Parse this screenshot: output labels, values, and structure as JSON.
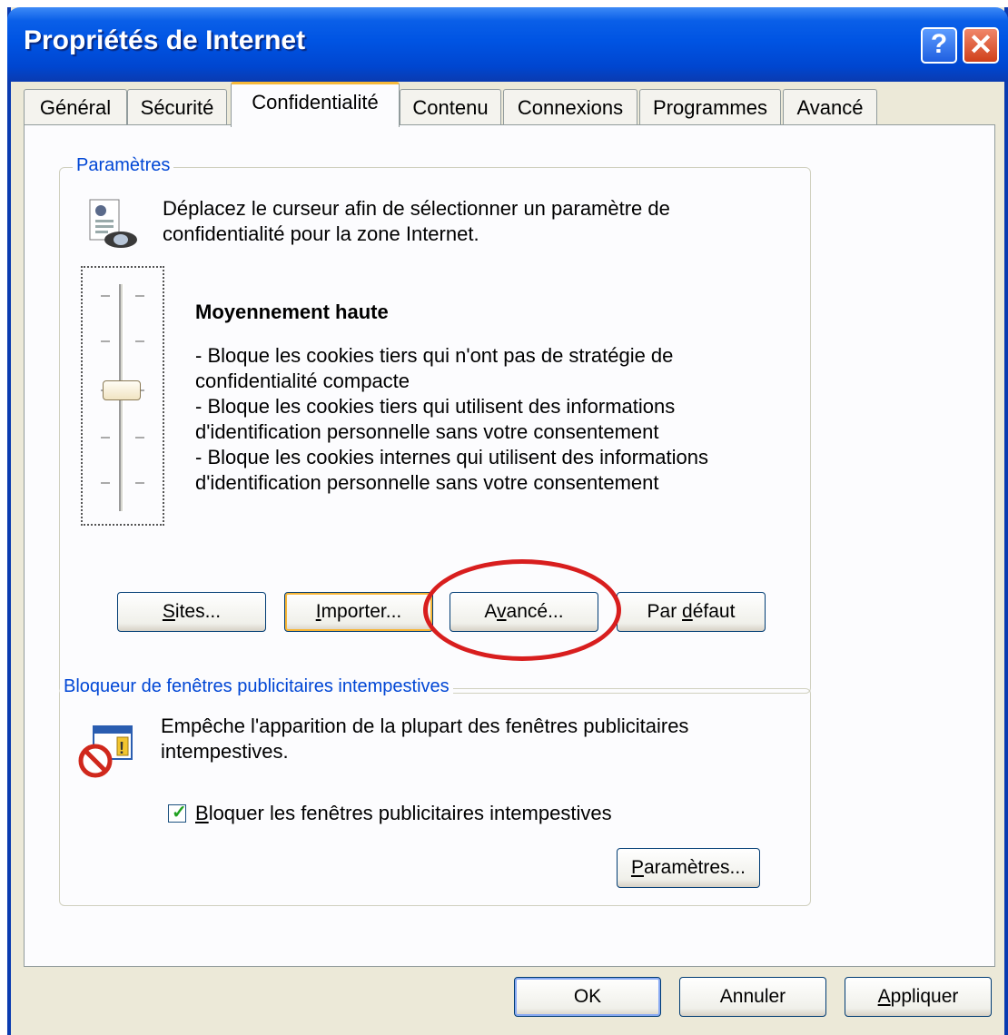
{
  "window": {
    "title": "Propriétés de Internet",
    "help_glyph": "?",
    "close_glyph": "✕"
  },
  "tabs": [
    {
      "label": "Général",
      "active": false
    },
    {
      "label": "Sécurité",
      "active": false
    },
    {
      "label": "Confidentialité",
      "active": true
    },
    {
      "label": "Contenu",
      "active": false
    },
    {
      "label": "Connexions",
      "active": false
    },
    {
      "label": "Programmes",
      "active": false
    },
    {
      "label": "Avancé",
      "active": false
    }
  ],
  "settings": {
    "legend": "Paramètres",
    "description_line1": "Déplacez le curseur afin de sélectionner un paramètre de",
    "description_line2": "confidentialité pour la zone Internet.",
    "level_title": "Moyennement haute",
    "level_lines": [
      "- Bloque les cookies tiers qui n'ont pas de stratégie de",
      "confidentialité compacte",
      "- Bloque les cookies tiers qui utilisent des informations",
      "d'identification personnelle sans votre consentement",
      "- Bloque les cookies internes qui utilisent des informations",
      "d'identification personnelle sans votre consentement"
    ],
    "slider_level": "3 of 6 (Moyennement haute)",
    "buttons": {
      "sites": {
        "pre": "",
        "key": "S",
        "post": "ites..."
      },
      "importer": {
        "pre": "",
        "key": "I",
        "post": "mporter..."
      },
      "avance": {
        "pre": "A",
        "key": "v",
        "post": "ancé..."
      },
      "par_defaut": {
        "pre": "Par ",
        "key": "d",
        "post": "éfaut"
      }
    }
  },
  "popup_blocker": {
    "legend": "Bloqueur de fenêtres publicitaires intempestives",
    "description_line1": "Empêche l'apparition de la plupart des fenêtres publicitaires",
    "description_line2": "intempestives.",
    "checkbox": {
      "pre": "",
      "key": "B",
      "post": "loquer les fenêtres publicitaires intempestives",
      "checked": true
    },
    "settings_button": {
      "pre": "",
      "key": "P",
      "post": "aramètres..."
    }
  },
  "footer": {
    "ok": "OK",
    "annuler": "Annuler",
    "appliquer": {
      "pre": "",
      "key": "A",
      "post": "ppliquer"
    }
  },
  "colors": {
    "titlebar": "#0054e3",
    "legend_text": "#0046d5",
    "annotation_circle": "#d81e1e"
  }
}
